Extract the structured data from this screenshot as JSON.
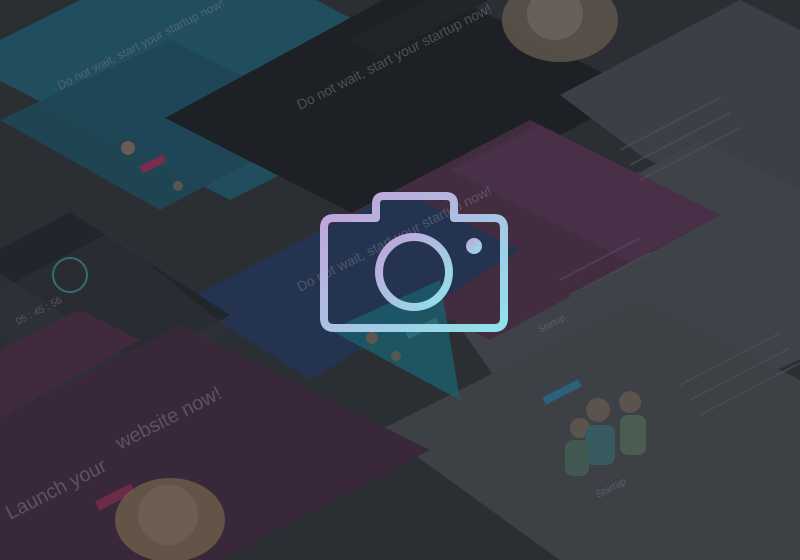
{
  "placeholder": {
    "icon": "camera-icon",
    "colors": {
      "background": "#2f3238",
      "icon_gradient_start": "#c9a2dd",
      "icon_gradient_end": "#8fe3ea"
    }
  },
  "collage": {
    "texts": {
      "headline_1": "Do not wait, start your startup now!",
      "headline_2": "Do not wait, start your startup now!",
      "headline_3": "website now!",
      "headline_4": "Launch your",
      "headline_5": "Do not wait, start your startup now!",
      "timer_value": "05 : 45 : 56",
      "section_label": "Startup",
      "menu_item": "Startup"
    },
    "colors": {
      "teal": "#1f5a69",
      "dark": "#1f2226",
      "navy": "#24365a",
      "plum": "#4b2e45",
      "light": "#4a4d53",
      "panel": "#3c3f45",
      "accent_pink": "#b2386a",
      "accent_blue": "#3a8fb6"
    }
  }
}
